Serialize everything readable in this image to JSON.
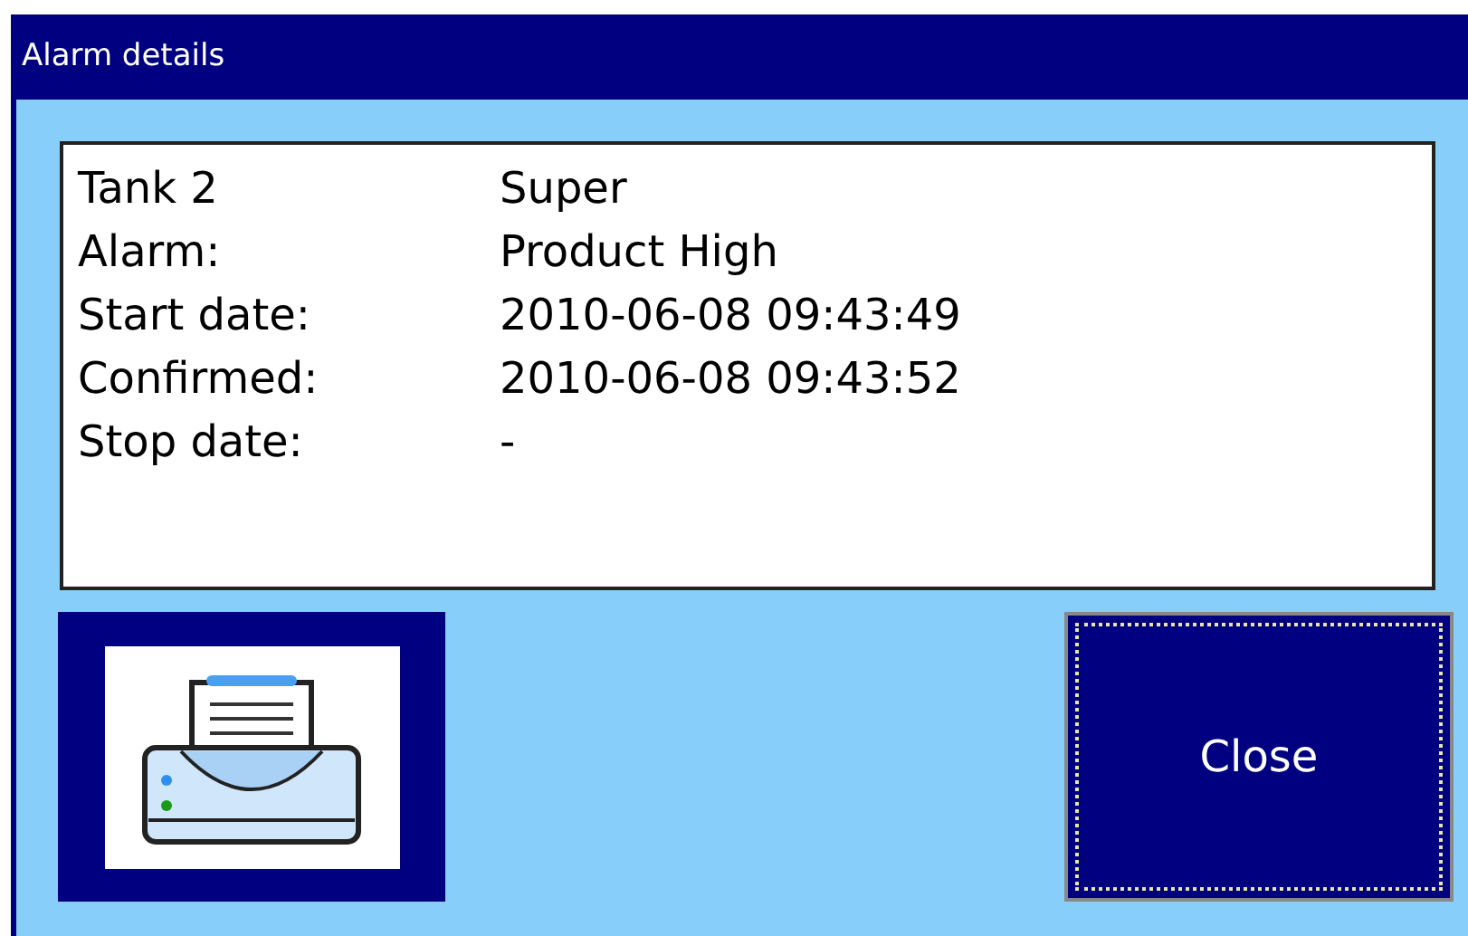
{
  "window": {
    "title": "Alarm details"
  },
  "details": [
    {
      "label": "Tank 2",
      "value": "Super"
    },
    {
      "label": "Alarm:",
      "value": "Product High"
    },
    {
      "label": "Start date:",
      "value": "2010-06-08 09:43:49"
    },
    {
      "label": "Confirmed:",
      "value": "2010-06-08 09:43:52"
    },
    {
      "label": "Stop date:",
      "value": "-"
    }
  ],
  "buttons": {
    "close": {
      "label": "Close",
      "focused": true
    }
  }
}
